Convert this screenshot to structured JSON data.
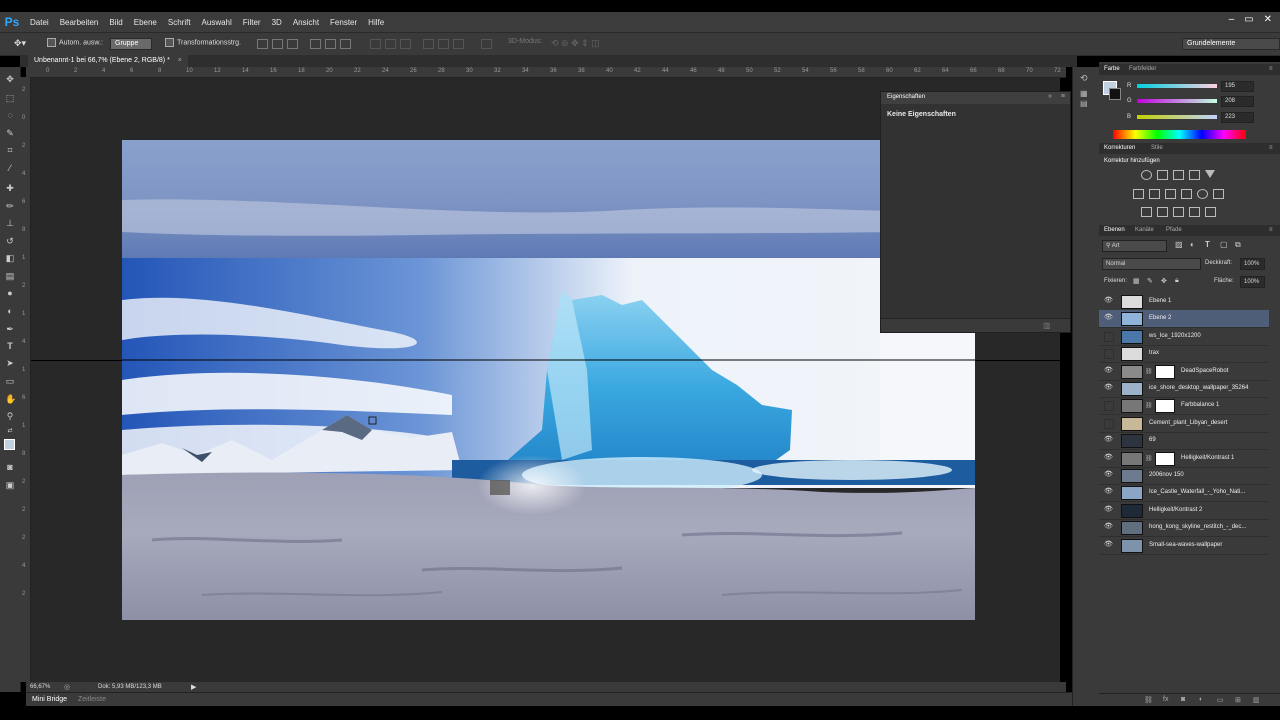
{
  "app": {
    "logo": "Ps"
  },
  "menu": [
    "Datei",
    "Bearbeiten",
    "Bild",
    "Ebene",
    "Schrift",
    "Auswahl",
    "Filter",
    "3D",
    "Ansicht",
    "Fenster",
    "Hilfe"
  ],
  "window_controls": [
    "–",
    "▭",
    "✕"
  ],
  "options": {
    "auto_select": "Autom. ausw.:",
    "group": "Gruppe",
    "transform": "Transformationsstrg.",
    "mode3d": "3D-Modus:",
    "workspace": "Grundelemente"
  },
  "document": {
    "tab_title": "Unbenannt-1 bei 66,7% (Ebene 2, RGB/8) *"
  },
  "rulers": {
    "h": [
      "0",
      "2",
      "4",
      "6",
      "8",
      "10",
      "12",
      "14",
      "16",
      "18",
      "20",
      "22",
      "24",
      "26",
      "28",
      "30",
      "32",
      "34",
      "36",
      "38",
      "40",
      "42",
      "44",
      "46",
      "48",
      "50",
      "52",
      "54",
      "56",
      "58",
      "60",
      "62",
      "64",
      "66",
      "68",
      "70",
      "72"
    ],
    "v": [
      "2",
      "0",
      "2",
      "4",
      "6",
      "8",
      "1",
      "2",
      "1",
      "4",
      "1",
      "6",
      "1",
      "8",
      "2",
      "2",
      "2",
      "4",
      "2"
    ]
  },
  "status": {
    "zoom": "66,67%",
    "doc": "Dok: 5,93 MB/123,3 MB"
  },
  "bottom_tabs": [
    "Mini Bridge",
    "Zeitleiste"
  ],
  "properties": {
    "title": "Eigenschaften",
    "text": "Keine Eigenschaften"
  },
  "color_panel": {
    "tabs": [
      "Farbe",
      "Farbfelder"
    ],
    "r_label": "R",
    "g_label": "G",
    "b_label": "B",
    "r": "195",
    "g": "208",
    "b": "223",
    "fg": "#c3d0df"
  },
  "adjustments": {
    "tabs": [
      "Korrekturen",
      "Stile"
    ],
    "heading": "Korrektur hinzufügen"
  },
  "layers_panel": {
    "tabs": [
      "Ebenen",
      "Kanäle",
      "Pfade"
    ],
    "filter": "Art",
    "blend": "Normal",
    "opacity_label": "Deckkraft:",
    "opacity": "100%",
    "lock_label": "Fixieren:",
    "fill_label": "Fläche:",
    "fill": "100%",
    "layers": [
      {
        "name": "Ebene 1",
        "visible": true,
        "sel": false,
        "mask": false,
        "thumb": "#dcdcdc"
      },
      {
        "name": "Ebene 2",
        "visible": true,
        "sel": true,
        "mask": false,
        "thumb": "#8fb3d9"
      },
      {
        "name": "ws_Ice_1920x1200",
        "visible": false,
        "sel": false,
        "mask": false,
        "thumb": "#4a78a8"
      },
      {
        "name": "trax",
        "visible": false,
        "sel": false,
        "mask": false,
        "thumb": "#dcdcdc"
      },
      {
        "name": "DeadSpaceRobot",
        "visible": true,
        "sel": false,
        "mask": true,
        "thumb": "#8a8a8a"
      },
      {
        "name": "ice_shore_desktop_wallpaper_35264",
        "visible": true,
        "sel": false,
        "mask": false,
        "thumb": "#9bb2c9"
      },
      {
        "name": "Farbbalance 1",
        "visible": false,
        "sel": false,
        "mask": true,
        "thumb": "#777777"
      },
      {
        "name": "Cement_plant_Libyan_desert",
        "visible": false,
        "sel": false,
        "mask": false,
        "thumb": "#c8b89a"
      },
      {
        "name": "69",
        "visible": true,
        "sel": false,
        "mask": false,
        "thumb": "#2c3440"
      },
      {
        "name": "Helligkeit/Kontrast 1",
        "visible": true,
        "sel": false,
        "mask": true,
        "thumb": "#777777"
      },
      {
        "name": "2006nov 150",
        "visible": true,
        "sel": false,
        "mask": false,
        "thumb": "#6c7b8f"
      },
      {
        "name": "Ice_Castle_Waterfall_-_Yoho_Nati...",
        "visible": true,
        "sel": false,
        "mask": false,
        "thumb": "#8aa6c4"
      },
      {
        "name": "Helligkeit/Kontrast 2",
        "visible": true,
        "sel": false,
        "mask": false,
        "thumb": "#1e2a38"
      },
      {
        "name": "hong_kong_skyline_restitch_-_dec...",
        "visible": true,
        "sel": false,
        "mask": false,
        "thumb": "#5f6f80"
      },
      {
        "name": "Small-sea-waves-wallpaper",
        "visible": true,
        "sel": false,
        "mask": false,
        "thumb": "#7d93ab"
      }
    ]
  }
}
